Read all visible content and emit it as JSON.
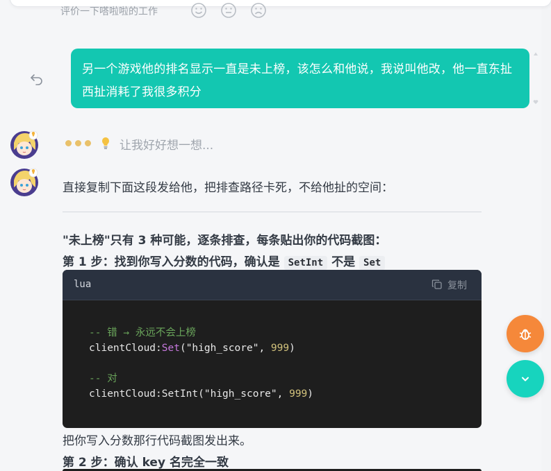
{
  "rating": {
    "label": "评价一下嗒啦啦的工作",
    "faces": [
      "happy-face-icon",
      "neutral-face-icon",
      "sad-face-icon"
    ]
  },
  "user_message": {
    "text": "另一个游戏他的排名显示一直是未上榜，该怎么和他说，我说叫他改，他一直东扯西扯消耗了我很多积分"
  },
  "assistant": {
    "thinking_text": "让我好好想一想...",
    "intro": "直接复制下面这段发给他，把排查路径卡死，不给他扯的空间：",
    "heading": "\"未上榜\"只有 3 种可能，逐条排查，每条贴出你的代码截图：",
    "step1": {
      "prefix": "第 1 步：找到你写入分数的代码，确认是",
      "code_a": "SetInt",
      "middle": "不是",
      "code_b": "Set"
    },
    "code": {
      "language": "lua",
      "copy_label": "复制",
      "line1_comment": "-- 错 → 永远不会上榜",
      "line2_obj": "clientCloud:",
      "line2_fn": "Set",
      "line2_args_a": "(\"high_score\", ",
      "line2_num": "999",
      "line2_close": ")",
      "line3_comment": "-- 对",
      "line4_obj": "clientCloud:SetInt",
      "line4_args_a": "(\"high_score\", ",
      "line4_num": "999",
      "line4_close": ")"
    },
    "after_code": "把你写入分数那行代码截图发出来。",
    "step2": "第 2 步：确认 key 名完全一致"
  },
  "colors": {
    "user_bubble": "#13c7b1",
    "bug_fab": "#f5883a",
    "scroll_fab": "#17d4be",
    "code_bg": "#1e1e1e"
  }
}
